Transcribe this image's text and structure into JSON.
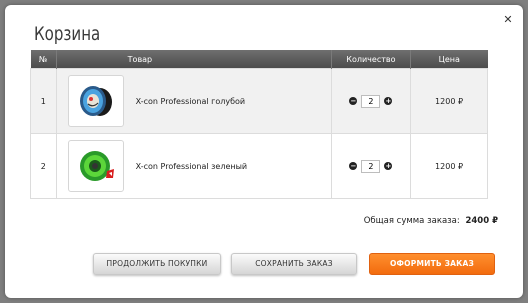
{
  "cart": {
    "title": "Корзина",
    "close_symbol": "✕",
    "columns": {
      "num": "№",
      "product": "Товар",
      "qty": "Количество",
      "price": "Цена"
    },
    "rows": [
      {
        "num": "1",
        "name": "X-con Professional голубой",
        "qty": "2",
        "price": "1200 ₽",
        "thumb_icon": "yoyo-blue-icon"
      },
      {
        "num": "2",
        "name": "X-con Professional зеленый",
        "qty": "2",
        "price": "1200 ₽",
        "thumb_icon": "yoyo-green-icon"
      }
    ],
    "qty_minus": "−",
    "qty_plus": "+",
    "total_label": "Общая сумма заказа:",
    "total_value": "2400 ₽",
    "buttons": {
      "continue": "ПРОДОЛЖИТЬ ПОКУПКИ",
      "save": "СОХРАНИТЬ ЗАКАЗ",
      "checkout": "ОФОРМИТЬ ЗАКАЗ"
    },
    "colors": {
      "accent": "#f57a1c",
      "header": "#5c5c5c"
    }
  }
}
